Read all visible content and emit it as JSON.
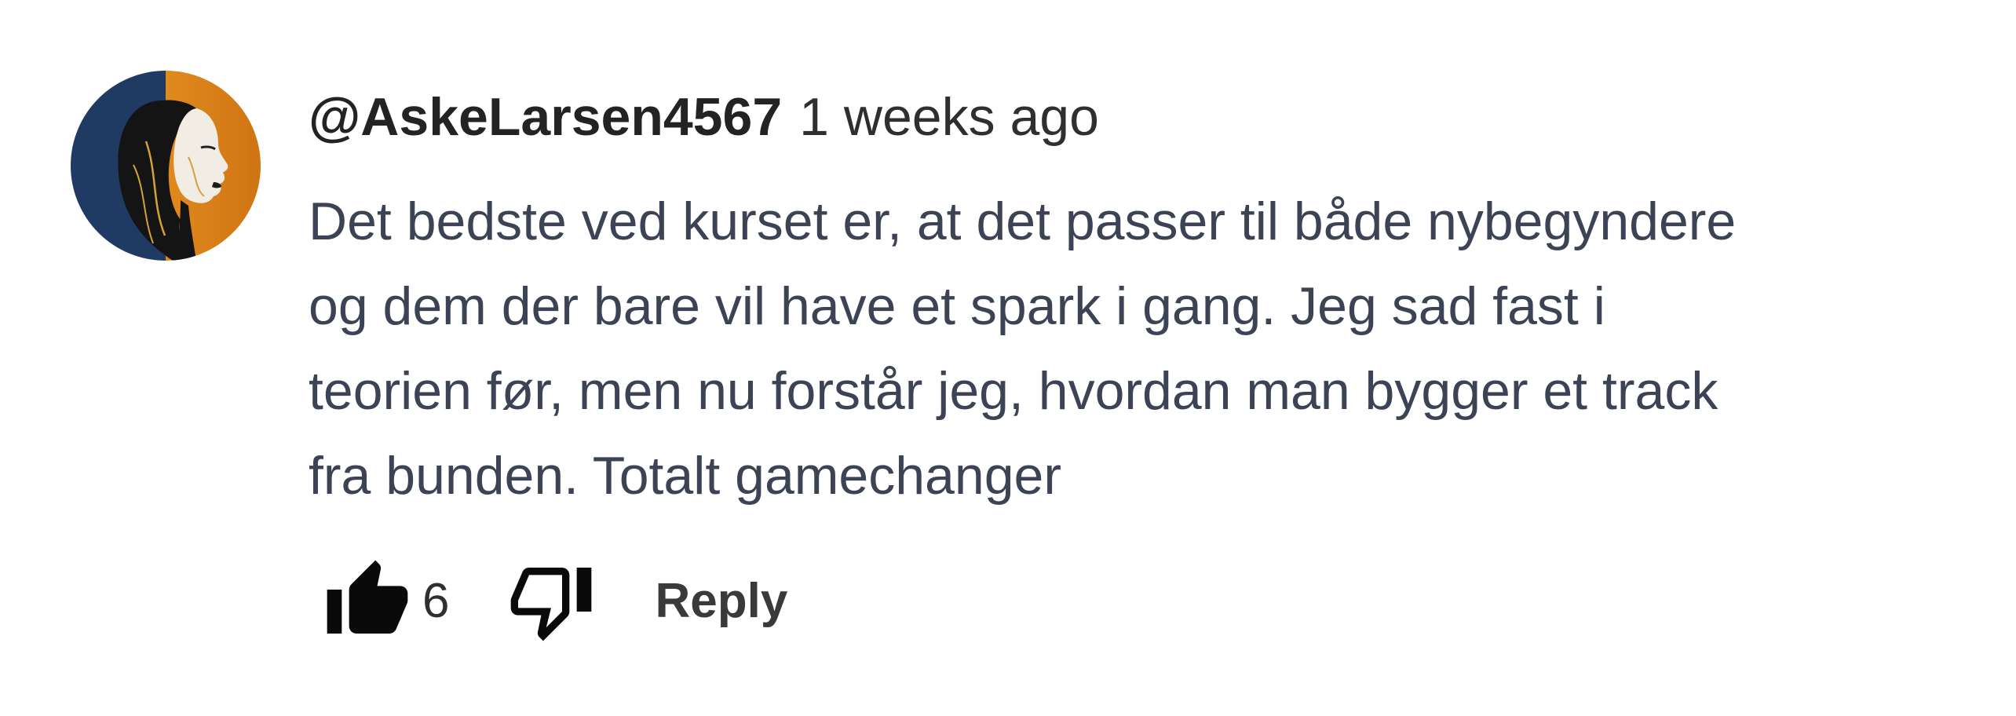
{
  "comment": {
    "author": "@AskeLarsen4567",
    "timestamp": "1 weeks ago",
    "text_lines": [
      "Det bedste ved kurset er, at det passer til både nybegyndere",
      "og dem der bare vil have et spark i gang. Jeg sad fast i",
      "teorien før, men nu forstår jeg, hvordan man bygger et track",
      "fra bunden. Totalt gamechanger"
    ],
    "like_count": "6",
    "reply_label": "Reply",
    "icons": {
      "like": "thumbs-up-icon",
      "dislike": "thumbs-down-icon"
    },
    "colors": {
      "avatar_left": "#1f3a63",
      "avatar_right": "#e08a1d",
      "text": "#3b4355"
    }
  }
}
